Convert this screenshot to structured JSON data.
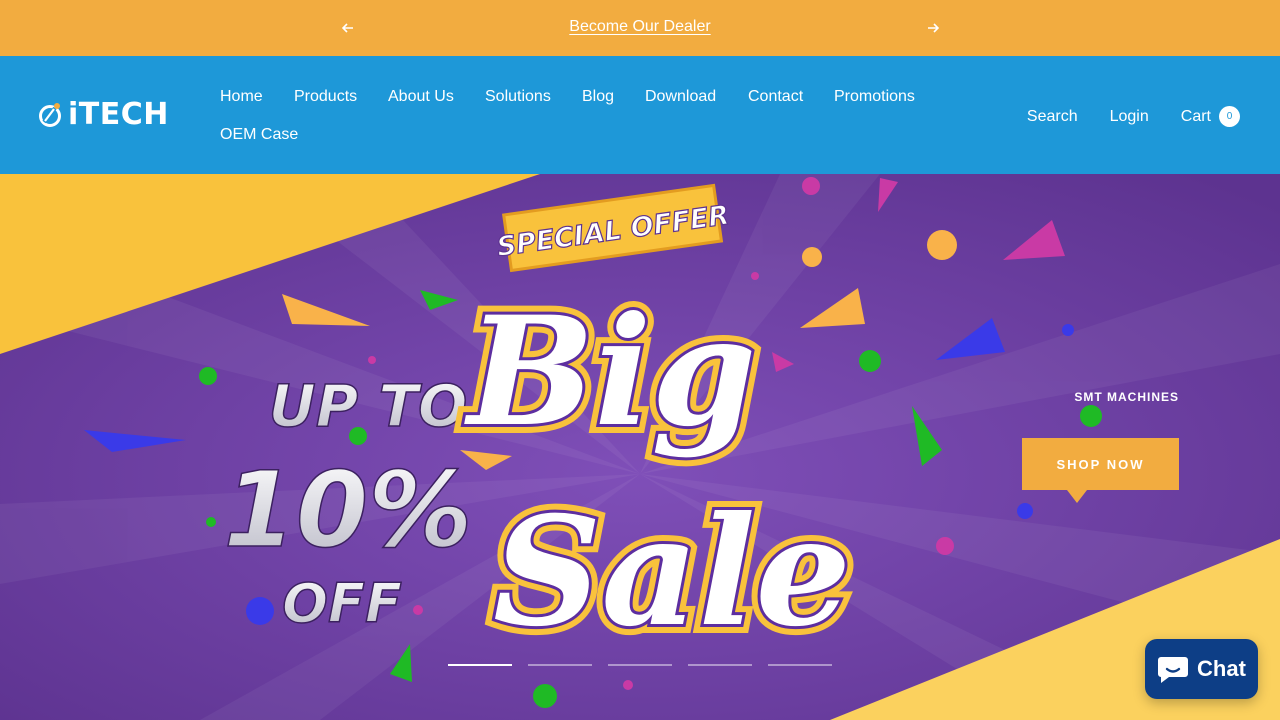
{
  "announcement": {
    "message": "Become Our Dealer",
    "prev_icon": "arrow-left-icon",
    "next_icon": "arrow-right-icon"
  },
  "header": {
    "logo_text": "iTECH",
    "nav": [
      {
        "label": "Home"
      },
      {
        "label": "Products"
      },
      {
        "label": "About Us"
      },
      {
        "label": "Solutions"
      },
      {
        "label": "Blog"
      },
      {
        "label": "Download"
      },
      {
        "label": "Contact"
      },
      {
        "label": "Promotions"
      },
      {
        "label": "OEM Case"
      }
    ],
    "search_label": "Search",
    "login_label": "Login",
    "cart_label": "Cart",
    "cart_count": "0"
  },
  "hero": {
    "badge": "SPECIAL OFFER",
    "line1": "UP TO",
    "line2": "10%",
    "line3": "OFF",
    "big_word1": "Big",
    "big_word2": "Sale",
    "subheading": "SMT MACHINES",
    "cta_label": "SHOP NOW",
    "slide_count": 5,
    "active_slide": 1
  },
  "chat": {
    "label": "Chat",
    "icon": "chat-bubble-icon"
  },
  "colors": {
    "announcement_bg": "#f2ac40",
    "header_bg": "#1e98d8",
    "hero_purple": "#6a3f9b",
    "hero_yellow": "#f9c23c",
    "chat_bg": "#0d3e86"
  }
}
